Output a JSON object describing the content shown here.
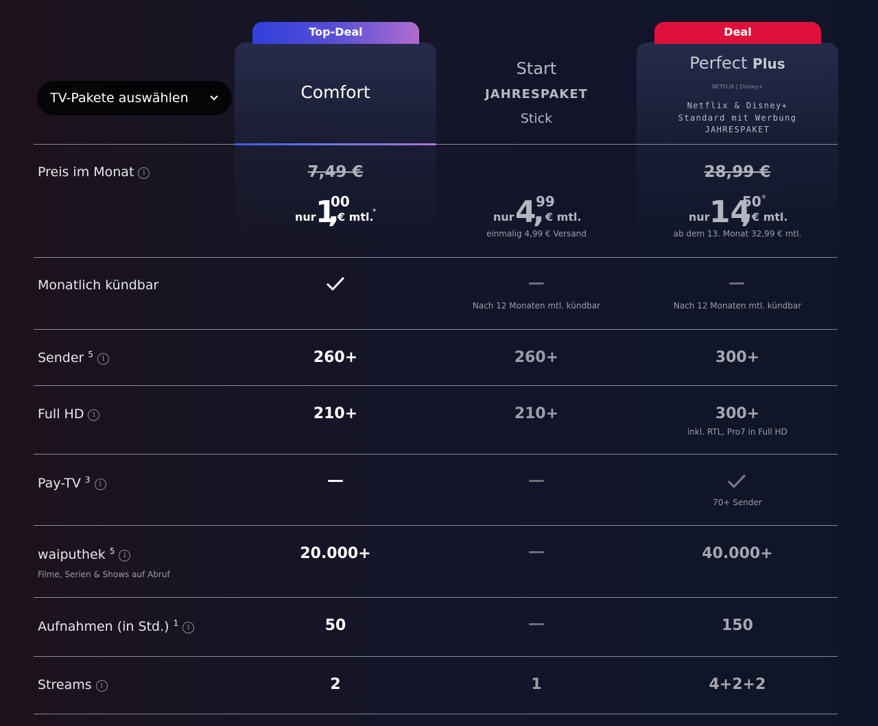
{
  "dropdown": {
    "label": "TV-Pakete auswählen"
  },
  "badges": {
    "comfort": "Top-Deal",
    "perfect": "Deal"
  },
  "columns": {
    "comfort": {
      "title": "Comfort"
    },
    "start": {
      "title": "Start",
      "subtitle": "JAHRESPAKET",
      "subtitle2": "Stick"
    },
    "perfect": {
      "title": "Perfect",
      "title_suffix": "Plus",
      "logos": "NETFLIX | Disney+",
      "sub1": "Netflix & Disney+",
      "sub2": "Standard mit Werbung",
      "sub3": "JAHRESPAKET"
    }
  },
  "rows": {
    "price": {
      "label": "Preis im Monat",
      "comfort": {
        "old": "7,49 €",
        "nur": "nur",
        "euros": "1",
        "comma": ",",
        "cents": "00",
        "unit": "€ mtl.",
        "star": "*"
      },
      "start": {
        "nur": "nur",
        "euros": "4",
        "comma": ",",
        "cents": "99",
        "unit": "€ mtl.",
        "note": "einmalig 4,99 € Versand"
      },
      "perfect": {
        "old": "28,99 €",
        "nur": "nur",
        "euros": "14",
        "comma": ",",
        "cents": "50",
        "star": "*",
        "unit": "€ mtl.",
        "note": "ab dem 13. Monat 32,99 € mtl."
      }
    },
    "cancel": {
      "label": "Monatlich kündbar",
      "start_note": "Nach 12 Monaten mtl. kündbar",
      "perfect_note": "Nach 12 Monaten mtl. kündbar"
    },
    "sender": {
      "label": "Sender",
      "sup": "5",
      "comfort": "260+",
      "start": "260+",
      "perfect": "300+"
    },
    "fullhd": {
      "label": "Full HD",
      "comfort": "210+",
      "start": "210+",
      "perfect": "300+",
      "perfect_note": "inkl. RTL, Pro7 in Full HD"
    },
    "paytv": {
      "label": "Pay-TV",
      "sup": "3",
      "perfect_note": "70+ Sender"
    },
    "waiputhek": {
      "label": "waiputhek",
      "sup": "5",
      "sub": "Filme, Serien & Shows auf Abruf",
      "comfort": "20.000+",
      "perfect": "40.000+"
    },
    "recordings": {
      "label": "Aufnahmen (in Std.)",
      "sup": "1",
      "comfort": "50",
      "perfect": "150"
    },
    "streams": {
      "label": "Streams",
      "comfort": "2",
      "start": "1",
      "perfect": "4+2+2"
    }
  },
  "icons": {
    "info": "info-icon",
    "check": "check-icon",
    "dash": "dash-icon",
    "chevron": "chevron-down-icon"
  }
}
